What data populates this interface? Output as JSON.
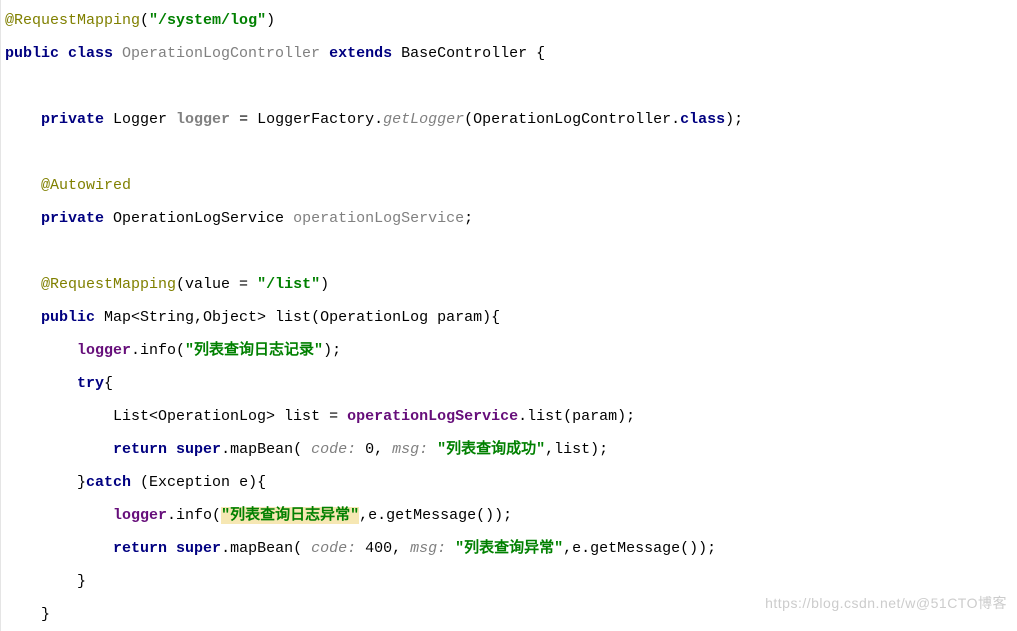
{
  "code": {
    "l1": {
      "ann": "@RequestMapping",
      "p1": "(",
      "str": "\"/system/log\"",
      "p2": ")"
    },
    "l2": {
      "kw1": "public class ",
      "cls": "OperationLogController ",
      "kw2": "extends ",
      "base": "BaseController {"
    },
    "l4": {
      "kw": "private ",
      "type": "Logger ",
      "field": "logger",
      "eq": " = LoggerFactory.",
      "call": "getLogger",
      "args": "(OperationLogController.",
      "cls": "class",
      "end": ");"
    },
    "l6": {
      "ann": "@Autowired"
    },
    "l7": {
      "kw": "private ",
      "type": "OperationLogService ",
      "field": "operationLogService",
      "end": ";"
    },
    "l9": {
      "ann": "@RequestMapping",
      "p1": "(value = ",
      "str": "\"/list\"",
      "p2": ")"
    },
    "l10": {
      "kw": "public ",
      "sig": "Map<String,Object> list(OperationLog param){"
    },
    "l11": {
      "pre": "",
      "fld": "logger",
      "call": ".info(",
      "str": "\"列表查询日志记录\"",
      "end": ");"
    },
    "l12": {
      "kw": "try",
      "p": "{"
    },
    "l13": {
      "type": "List<OperationLog> list = ",
      "fld": "operationLogService",
      "end": ".list(param);"
    },
    "l14": {
      "kw": "return super",
      "call": ".mapBean( ",
      "h1": "code:",
      "v1": " 0, ",
      "h2": "msg:",
      "sp": " ",
      "str": "\"列表查询成功\"",
      "end": ",list);"
    },
    "l15": {
      "close": "}",
      "kw": "catch ",
      "p": "(Exception e){"
    },
    "l16": {
      "fld": "logger",
      "call": ".info(",
      "str": "\"列表查询日志异常\"",
      "end": ",e.getMessage());"
    },
    "l17": {
      "kw": "return super",
      "call": ".mapBean( ",
      "h1": "code:",
      "v1": " 400, ",
      "h2": "msg:",
      "sp": " ",
      "str": "\"列表查询异常\"",
      "end": ",e.getMessage());"
    },
    "l18": {
      "close": "}"
    },
    "l19": {
      "close": "}"
    }
  },
  "watermark": "https://blog.csdn.net/w@51CTO博客"
}
